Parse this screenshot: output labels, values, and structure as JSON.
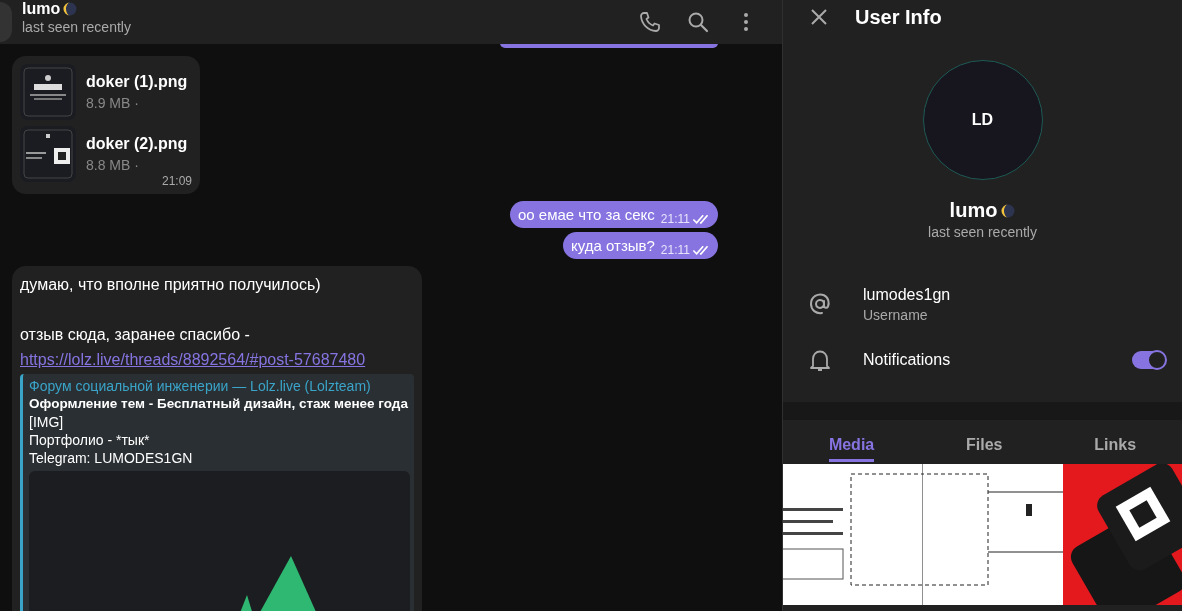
{
  "chat_header": {
    "name": "lumo",
    "status": "last seen recently"
  },
  "messages": [
    {
      "kind": "clipped",
      "outgoing": true
    },
    {
      "kind": "files",
      "outgoing": false,
      "files": [
        {
          "name": "doker (1).png",
          "size": "8.9 MB ·"
        },
        {
          "name": "doker (2).png",
          "size": "8.8 MB ·"
        }
      ],
      "time": "21:09"
    },
    {
      "kind": "text",
      "outgoing": true,
      "text": "оо емае что за секс",
      "time": "21:11",
      "read": true
    },
    {
      "kind": "text",
      "outgoing": true,
      "text": "куда отзыв?",
      "time": "21:11",
      "read": true
    },
    {
      "kind": "rich",
      "outgoing": false,
      "paragraphs": [
        "думаю, что вполне приятно получилось)",
        "отзыв сюда, заранее спасибо -"
      ],
      "link": "https://lolz.live/threads/8892564/#post-57687480",
      "preview": {
        "site": "Форум социальной инженерии — Lolz.live (Lolzteam)",
        "title": "Оформление тем - Бесплатный дизайн, стаж менее года",
        "body": [
          "[IMG]",
          "Портфолио - *тык*",
          "Telegram: LUMODES1GN"
        ]
      }
    }
  ],
  "user_info": {
    "title": "User Info",
    "profile": {
      "avatar_text": "LD",
      "name": "lumo",
      "status": "last seen recently"
    },
    "rows": [
      {
        "kind": "username",
        "value": "lumodes1gn",
        "label": "Username"
      },
      {
        "kind": "notifications",
        "label": "Notifications",
        "on": true
      }
    ],
    "tabs": [
      {
        "label": "Media",
        "selected": true
      },
      {
        "label": "Files",
        "selected": false
      },
      {
        "label": "Links",
        "selected": false
      }
    ]
  }
}
